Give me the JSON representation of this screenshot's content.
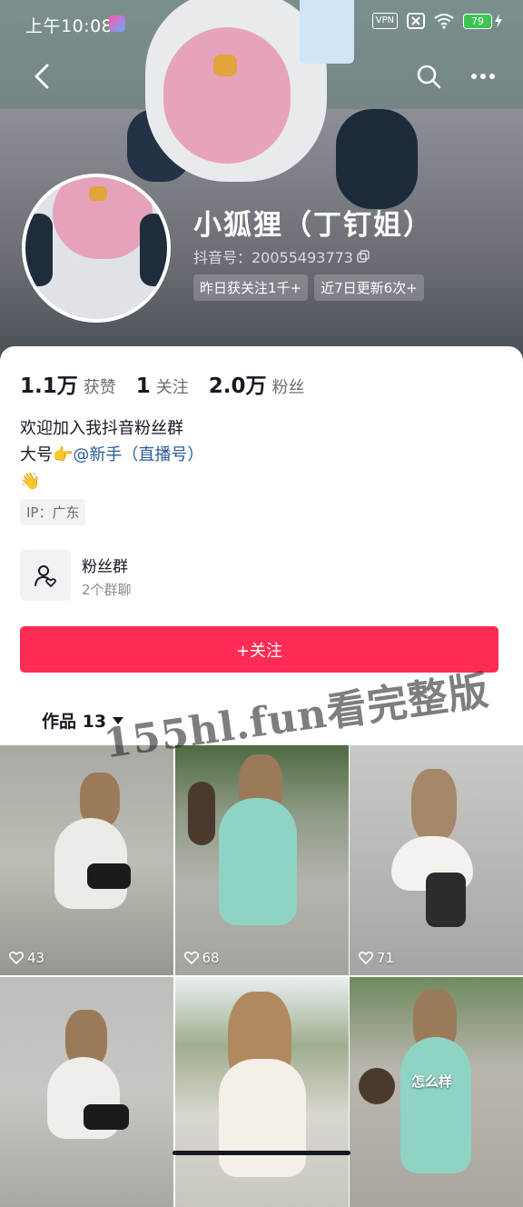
{
  "status_bar": {
    "time": "上午10:08",
    "vpn": "VPN",
    "battery": "79"
  },
  "profile": {
    "name": "小狐狸（丁钉姐）",
    "douyin_id": "抖音号：20055493773",
    "tags": [
      "昨日获关注1千+",
      "近7日更新6次+"
    ]
  },
  "stats": [
    {
      "value": "1.1万",
      "label": "获赞"
    },
    {
      "value": "1",
      "label": "关注"
    },
    {
      "value": "2.0万",
      "label": "粉丝"
    }
  ],
  "bio": {
    "line1": "欢迎加入我抖音粉丝群",
    "line2_prefix": "大号👉",
    "line2_mention": "@新手（直播号）",
    "line3": "👋"
  },
  "ip": "IP：广东",
  "fan_group": {
    "title": "粉丝群",
    "subtitle": "2个群聊"
  },
  "follow_button": "+关注",
  "works_tab": "作品 13",
  "watermark": "155hl.fun看完整版",
  "videos": [
    {
      "likes": "43",
      "overlay": ""
    },
    {
      "likes": "68",
      "overlay": ""
    },
    {
      "likes": "71",
      "overlay": ""
    },
    {
      "likes": "",
      "overlay": ""
    },
    {
      "likes": "",
      "overlay": ""
    },
    {
      "likes": "",
      "overlay": "怎么样"
    }
  ],
  "colors": {
    "accent": "#fe2c55",
    "mention": "#2a5b98"
  }
}
